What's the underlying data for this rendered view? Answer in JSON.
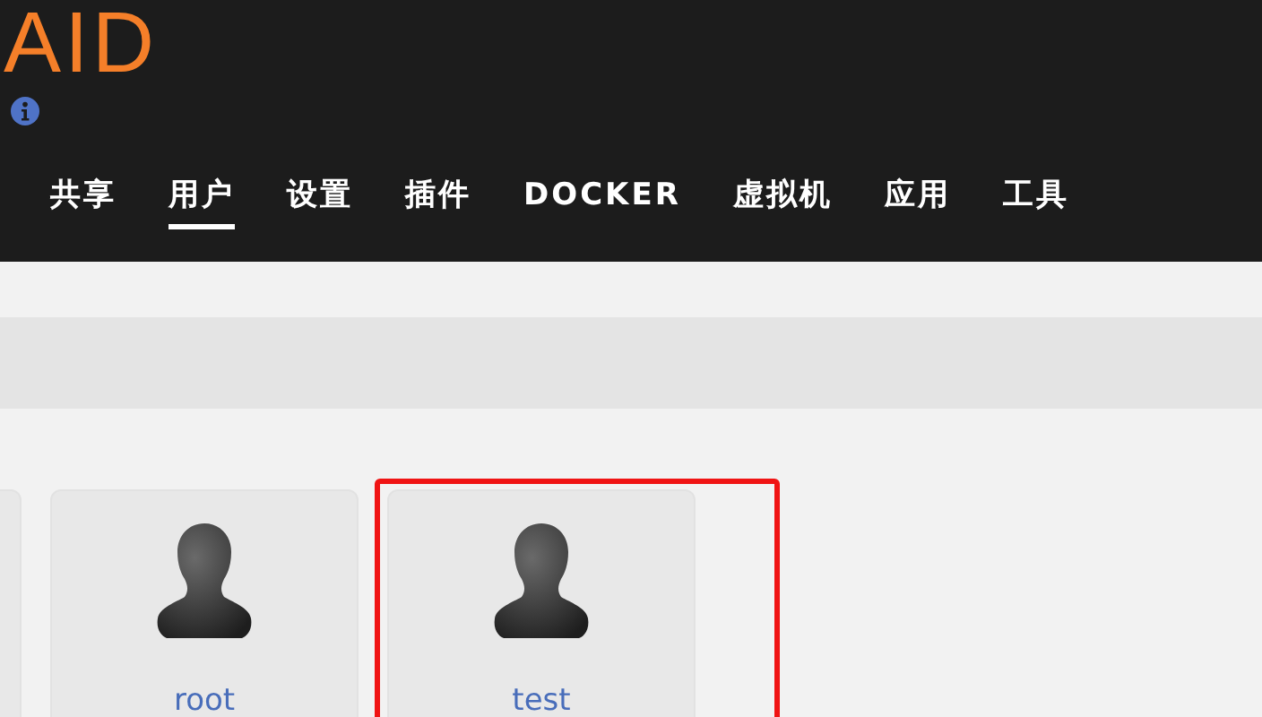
{
  "header": {
    "logo": "AID",
    "nav": [
      {
        "label": "共享",
        "selected": false
      },
      {
        "label": "用户",
        "selected": true
      },
      {
        "label": "设置",
        "selected": false
      },
      {
        "label": "插件",
        "selected": false
      },
      {
        "label": "DOCKER",
        "selected": false
      },
      {
        "label": "虚拟机",
        "selected": false
      },
      {
        "label": "应用",
        "selected": false
      },
      {
        "label": "工具",
        "selected": false
      }
    ]
  },
  "users": [
    {
      "kind": "partial",
      "highlighted": false
    },
    {
      "kind": "full",
      "name": "root",
      "highlighted": false
    },
    {
      "kind": "full",
      "name": "test",
      "highlighted": true
    }
  ]
}
